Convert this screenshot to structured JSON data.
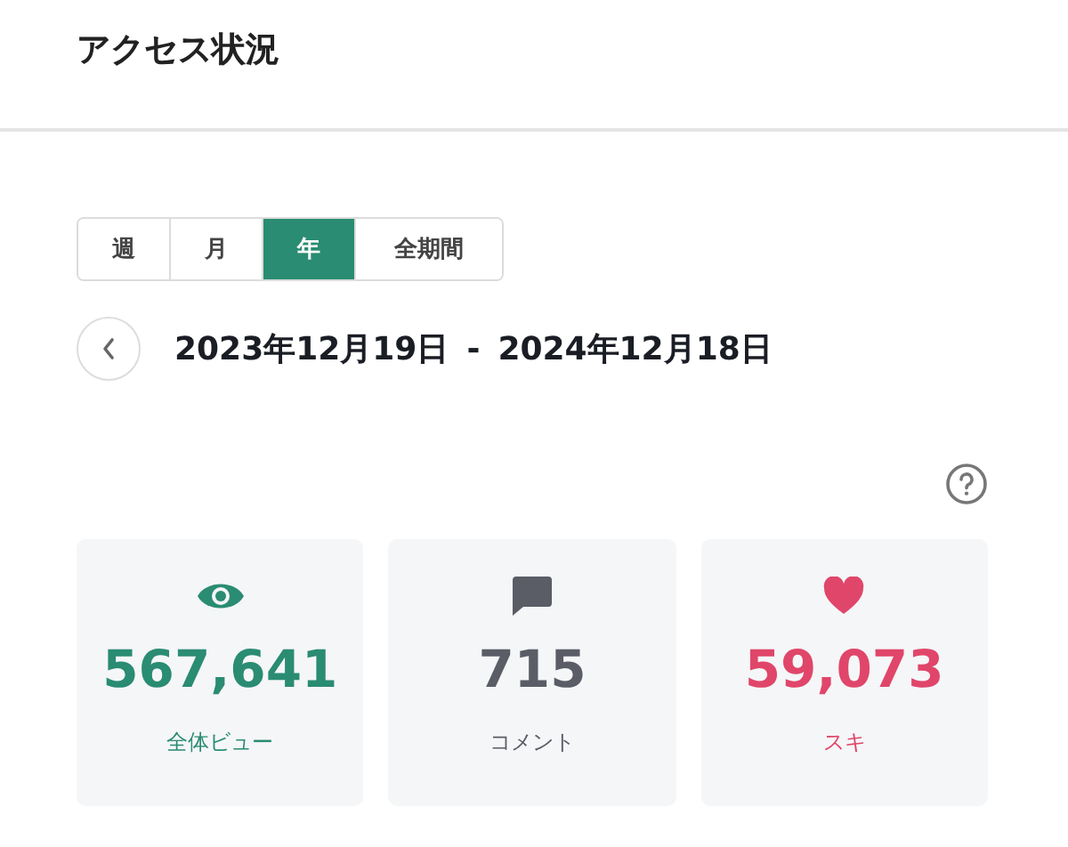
{
  "header": {
    "title": "アクセス状況"
  },
  "period_tabs": [
    {
      "label": "週",
      "selected": false
    },
    {
      "label": "月",
      "selected": false
    },
    {
      "label": "年",
      "selected": true
    },
    {
      "label": "全期間",
      "selected": false
    }
  ],
  "date_range": {
    "start": "2023年12月19日",
    "separator": "-",
    "end": "2024年12月18日"
  },
  "stats": [
    {
      "kind": "views",
      "value": "567,641",
      "label": "全体ビュー",
      "color": "#2a8c72"
    },
    {
      "kind": "comments",
      "value": "715",
      "label": "コメント",
      "color": "#5a5d66"
    },
    {
      "kind": "likes",
      "value": "59,073",
      "label": "スキ",
      "color": "#e0466a"
    }
  ]
}
